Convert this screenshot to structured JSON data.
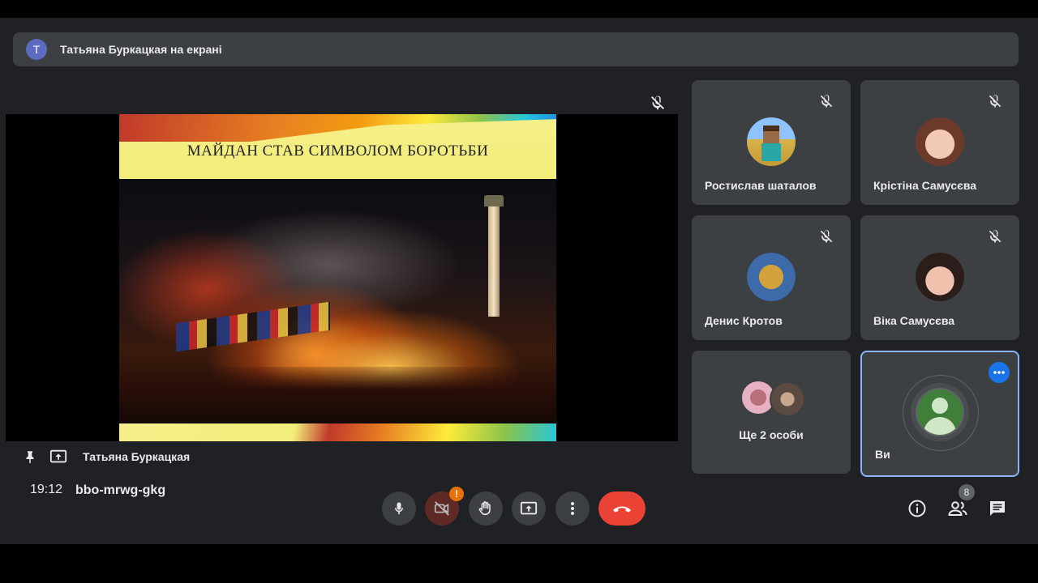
{
  "banner": {
    "avatar_letter": "Т",
    "text": "Татьяна Буркацкая на екрані"
  },
  "presentation": {
    "slide_title": "МАЙДАН СТАВ СИМВОЛОМ БОРОТЬБИ",
    "presenter_label": "Татьяна Буркацкая"
  },
  "participants": [
    {
      "name": "Ростислав шаталов",
      "muted": true
    },
    {
      "name": "Крістіна Самусєва",
      "muted": true
    },
    {
      "name": "Денис Кротов",
      "muted": true
    },
    {
      "name": "Віка Самусєва",
      "muted": true
    }
  ],
  "more_people": {
    "label": "Ще 2 особи"
  },
  "self_tile": {
    "name": "Ви"
  },
  "toolbar": {
    "time": "19:12",
    "meeting_code": "bbo-mrwg-gkg",
    "camera_alert": "!",
    "participant_count": "8"
  },
  "colors": {
    "accent": "#8ab4f8",
    "end_call": "#ea4335",
    "alert": "#e8710a"
  }
}
